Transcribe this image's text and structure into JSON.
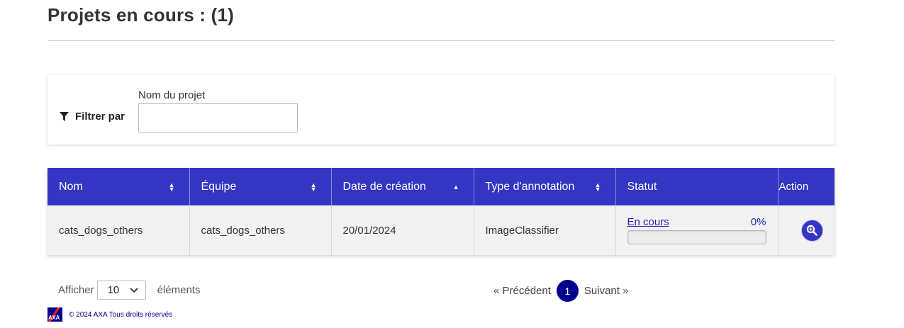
{
  "page": {
    "title": "Projets en cours : (1)"
  },
  "filter": {
    "label": "Filtrer par",
    "field_label": "Nom du projet",
    "field_value": ""
  },
  "table": {
    "headers": {
      "name": "Nom",
      "team": "Équipe",
      "created": "Date de création",
      "annotation_type": "Type d'annotation",
      "status": "Statut",
      "action": "Action"
    },
    "rows": [
      {
        "name": "cats_dogs_others",
        "team": "cats_dogs_others",
        "created": "20/01/2024",
        "annotation_type": "ImageClassifier",
        "status": "En cours",
        "progress_label": "0%",
        "progress": 0
      }
    ]
  },
  "page_size": {
    "prefix": "Afficher",
    "value": "10",
    "suffix": "éléments"
  },
  "pagination": {
    "prev": "« Précédent",
    "current": "1",
    "next": "Suivant »"
  },
  "footer": {
    "logo_text": "AXA",
    "copyright": "© 2024 AXA Tous droits réservés"
  },
  "colors": {
    "header_bg": "#3535c4",
    "brand_blue": "#00008f",
    "logo_red": "#ff1721"
  },
  "icons": [
    "filter-icon",
    "sort-icon",
    "sort-asc-icon",
    "zoom-icon",
    "chevron-down-icon",
    "axa-logo"
  ]
}
